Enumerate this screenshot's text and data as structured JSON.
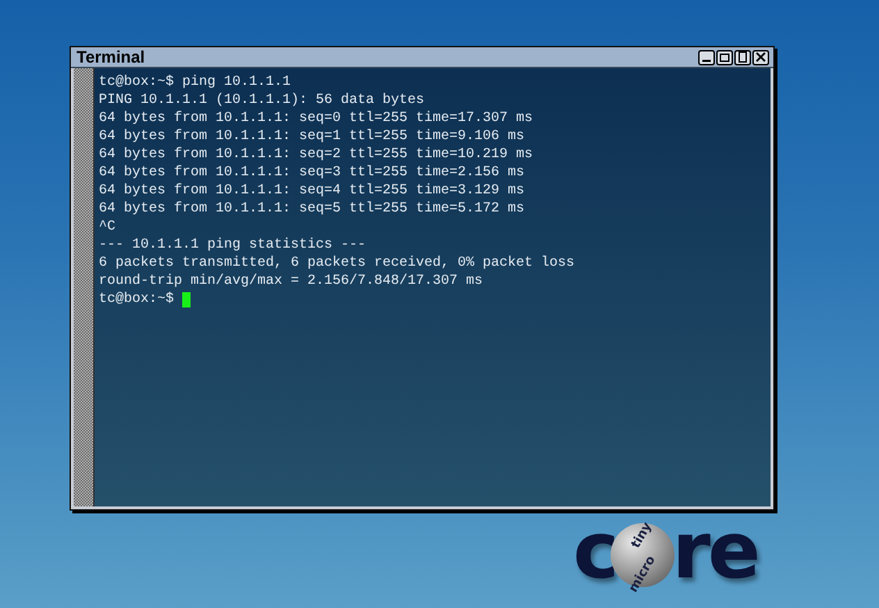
{
  "window": {
    "title": "Terminal"
  },
  "terminal": {
    "lines": [
      "tc@box:~$ ping 10.1.1.1",
      "PING 10.1.1.1 (10.1.1.1): 56 data bytes",
      "64 bytes from 10.1.1.1: seq=0 ttl=255 time=17.307 ms",
      "64 bytes from 10.1.1.1: seq=1 ttl=255 time=9.106 ms",
      "64 bytes from 10.1.1.1: seq=2 ttl=255 time=10.219 ms",
      "64 bytes from 10.1.1.1: seq=3 ttl=255 time=2.156 ms",
      "64 bytes from 10.1.1.1: seq=4 ttl=255 time=3.129 ms",
      "64 bytes from 10.1.1.1: seq=5 ttl=255 time=5.172 ms",
      "^C",
      "--- 10.1.1.1 ping statistics ---",
      "6 packets transmitted, 6 packets received, 0% packet loss",
      "round-trip min/avg/max = 2.156/7.848/17.307 ms"
    ],
    "prompt": "tc@box:~$"
  },
  "logo": {
    "left": "c",
    "right": "re",
    "top_word": "tiny",
    "bottom_word": "micro"
  }
}
